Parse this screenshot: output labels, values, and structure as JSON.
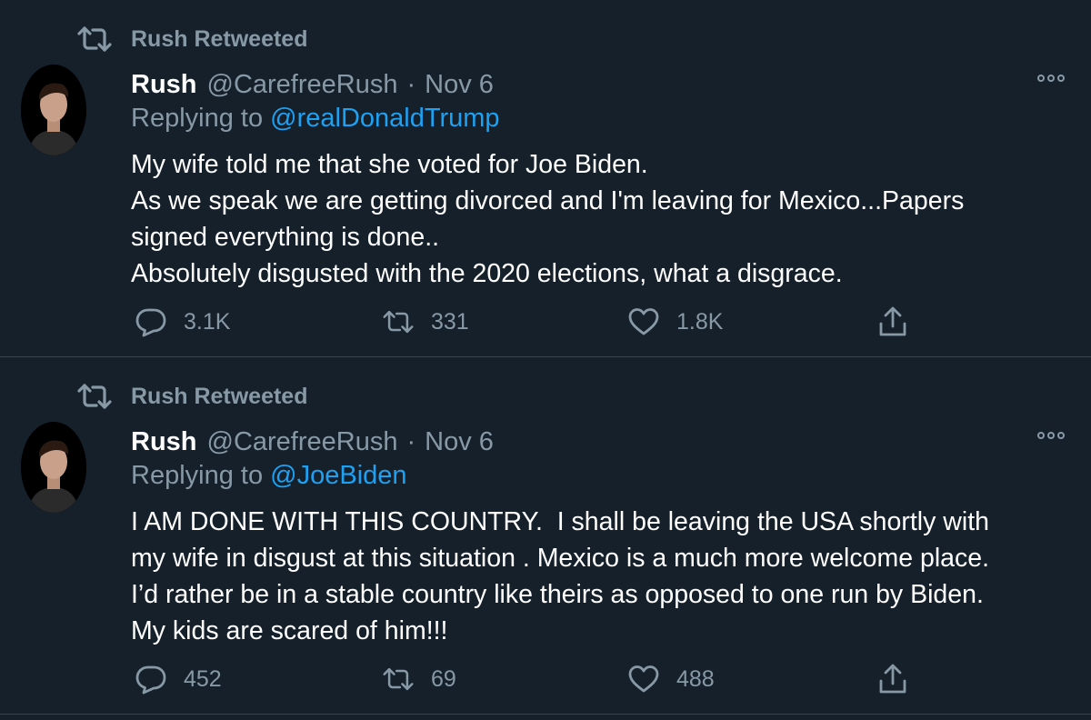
{
  "colors": {
    "background": "#15202b",
    "secondary_text": "#8899a6",
    "link": "#1da1f2",
    "divider": "#38444d"
  },
  "icons": {
    "retweet": "retweet-icon",
    "reply": "reply-bubble-icon",
    "like": "heart-icon",
    "share": "share-upload-icon",
    "more": "more-options-icon"
  },
  "tweets": [
    {
      "retweeted_label": "Rush Retweeted",
      "name": "Rush",
      "handle": "@CarefreeRush",
      "separator": "·",
      "date": "Nov 6",
      "replying_prefix": "Replying to ",
      "replying_to": "@realDonaldTrump",
      "text_lines": [
        "My wife told me that she voted for Joe Biden.",
        "As we speak we are getting divorced and I'm leaving for Mexico...Papers",
        "signed everything is done..",
        "Absolutely disgusted with the 2020 elections, what a disgrace."
      ],
      "replies": "3.1K",
      "retweets": "331",
      "likes": "1.8K"
    },
    {
      "retweeted_label": "Rush Retweeted",
      "name": "Rush",
      "handle": "@CarefreeRush",
      "separator": "·",
      "date": "Nov 6",
      "replying_prefix": "Replying to ",
      "replying_to": "@JoeBiden",
      "text_lines": [
        "I AM DONE WITH THIS COUNTRY.  I shall be leaving the USA shortly with",
        "my wife in disgust at this situation . Mexico is a much more welcome place.",
        "I’d rather be in a stable country like theirs as opposed to one run by Biden.",
        "My kids are scared of him!!!"
      ],
      "replies": "452",
      "retweets": "69",
      "likes": "488"
    }
  ]
}
